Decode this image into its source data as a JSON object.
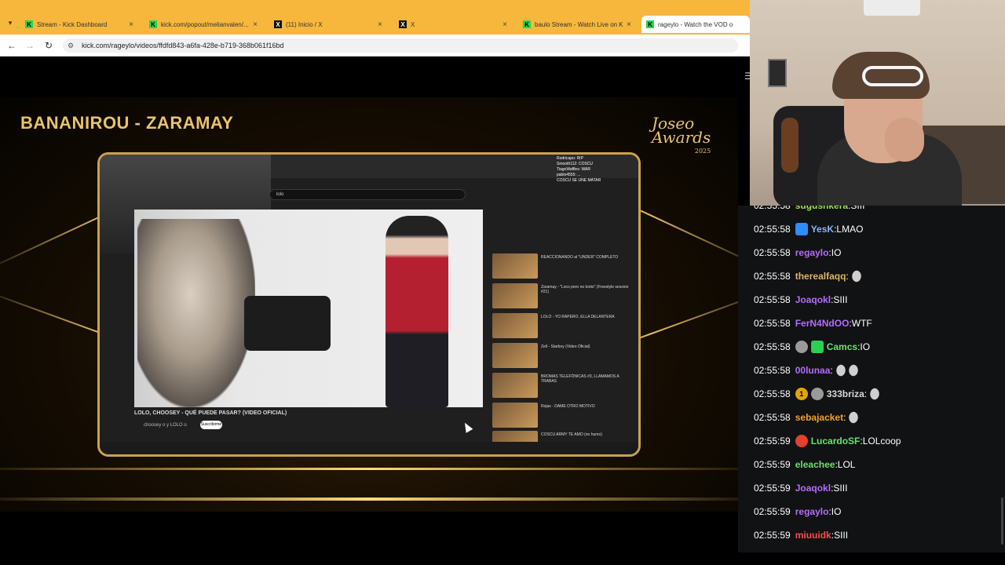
{
  "browser": {
    "tabs": [
      {
        "icon": "kick",
        "title": "Stream - Kick Dashboard"
      },
      {
        "icon": "kick",
        "title": "kick.com/popout/melianvalen/..."
      },
      {
        "icon": "x",
        "title": "(11) Inicio / X"
      },
      {
        "icon": "x",
        "title": "X"
      },
      {
        "icon": "kick",
        "title": "baulo Stream - Watch Live on K"
      },
      {
        "icon": "kick",
        "title": "rageylo - Watch the VOD o"
      }
    ],
    "url": "kick.com/rageylo/videos/ffdfd843-a6fa-428e-b719-368b061f16bd"
  },
  "stream": {
    "award_title": "BANANIROU - ZARAMAY",
    "award_logo_line1": "Joseo",
    "award_logo_line2": "Awards",
    "award_logo_year": "2025",
    "embedded": {
      "search_text": "lolo",
      "video_title": "LOLO, CHOOSEY - QUÉ PUEDE PASAR? (VIDEO OFICIAL)",
      "channel": "choosey o y LOLO o",
      "subscribe": "Suscribirme",
      "chat_overlay": [
        "Rodricapo: RIP",
        "Smooth112: COSCU",
        "TiagoWaffles: WAR",
        "pablo4555: ...",
        "COSCU SE UNE MATAR"
      ],
      "recommended": [
        "REACCIONANDO al \"UNDER\" COMPLETO",
        "Zaramay - \"Loco pero no tonto\" (Freestyle session #21)",
        "LOLO - YO RAPERO, ELLA DELANTERA",
        "Zell - Starboy (Video Oficial)",
        "BROMAS TELEFÓNICAS #3, LLAMAMOS A TRABAS",
        "Rojas - DAME OTRO MOTIVO",
        "COSCU ARMY TE AMO (no humo)"
      ]
    }
  },
  "chat": {
    "messages": [
      {
        "time": "02:55:58",
        "user": "sugusnkera",
        "color": "#9be34a",
        "text": "SIII",
        "badges": [],
        "emotes": 0
      },
      {
        "time": "02:55:58",
        "user": "YesK",
        "color": "#8ab4ff",
        "text": "LMAO",
        "badges": [
          "blue-badge"
        ],
        "emotes": 0
      },
      {
        "time": "02:55:58",
        "user": "regaylo",
        "color": "#b46cff",
        "text": "IO",
        "badges": [],
        "emotes": 0
      },
      {
        "time": "02:55:58",
        "user": "therealfaqq",
        "color": "#e0b36a",
        "text": "",
        "badges": [],
        "emotes": 1
      },
      {
        "time": "02:55:58",
        "user": "Joaqokl",
        "color": "#b46cff",
        "text": "SIII",
        "badges": [],
        "emotes": 0
      },
      {
        "time": "02:55:58",
        "user": "FerN4NdOO",
        "color": "#b46cff",
        "text": "WTF",
        "badges": [],
        "emotes": 0
      },
      {
        "time": "02:55:58",
        "user": "Camcs",
        "color": "#6ee06e",
        "text": "IO",
        "badges": [
          "gray-badge",
          "green-badge"
        ],
        "emotes": 0
      },
      {
        "time": "02:55:58",
        "user": "00lunaa",
        "color": "#b46cff",
        "text": "",
        "badges": [],
        "emotes": 2
      },
      {
        "time": "02:55:58",
        "user": "333briza",
        "color": "#d8d8d8",
        "text": "",
        "badges": [
          "gold-badge",
          "gray-badge"
        ],
        "emotes": 1
      },
      {
        "time": "02:55:58",
        "user": "sebajacket",
        "color": "#f0a030",
        "text": "",
        "badges": [],
        "emotes": 1
      },
      {
        "time": "02:55:59",
        "user": "LucardoSF",
        "color": "#6ee06e",
        "text": "LOLcoop",
        "badges": [
          "red-badge"
        ],
        "emotes": 0
      },
      {
        "time": "02:55:59",
        "user": "eleachee",
        "color": "#6ee06e",
        "text": "LOL",
        "badges": [],
        "emotes": 0
      },
      {
        "time": "02:55:59",
        "user": "Joaqokl",
        "color": "#b46cff",
        "text": "SIII",
        "badges": [],
        "emotes": 0
      },
      {
        "time": "02:55:59",
        "user": "regaylo",
        "color": "#b46cff",
        "text": "IO",
        "badges": [],
        "emotes": 0
      },
      {
        "time": "02:55:59",
        "user": "miuuidk",
        "color": "#ff4d4d",
        "text": "SIII",
        "badges": [],
        "emotes": 0
      }
    ]
  }
}
